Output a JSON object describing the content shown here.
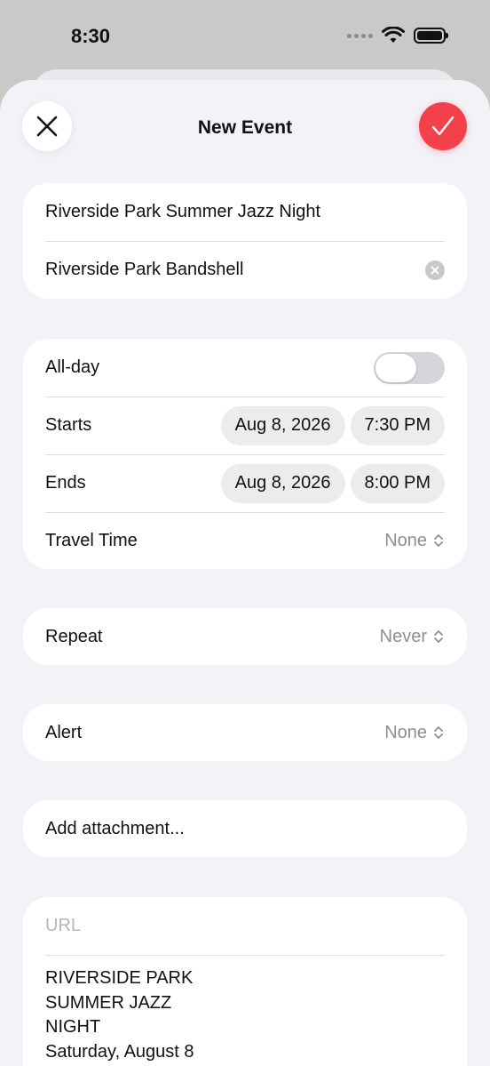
{
  "status": {
    "time": "8:30"
  },
  "header": {
    "title": "New Event"
  },
  "event": {
    "title": "Riverside Park Summer Jazz Night",
    "location": "Riverside Park Bandshell"
  },
  "schedule": {
    "allday_label": "All-day",
    "allday_on": false,
    "starts_label": "Starts",
    "starts_date": "Aug 8, 2026",
    "starts_time": "7:30 PM",
    "ends_label": "Ends",
    "ends_date": "Aug 8, 2026",
    "ends_time": "8:00 PM",
    "travel_label": "Travel Time",
    "travel_value": "None"
  },
  "repeat": {
    "label": "Repeat",
    "value": "Never"
  },
  "alert": {
    "label": "Alert",
    "value": "None"
  },
  "attachment": {
    "label": "Add attachment..."
  },
  "url": {
    "placeholder": "URL"
  },
  "notes": {
    "line1": "RIVERSIDE PARK",
    "line2": "SUMMER JAZZ",
    "line3": "NIGHT",
    "line4": "Saturday, August 8"
  },
  "colors": {
    "accent": "#f4404a",
    "background": "#f2f2f7"
  }
}
